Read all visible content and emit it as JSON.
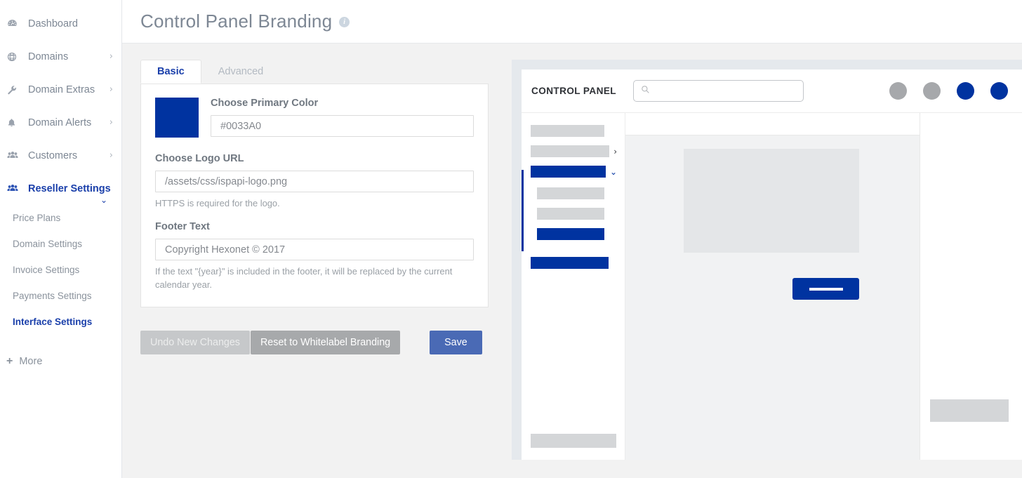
{
  "sidebar": {
    "items": [
      {
        "label": "Dashboard",
        "icon": "dashboard-icon",
        "caret": "",
        "active": false
      },
      {
        "label": "Domains",
        "icon": "globe-icon",
        "caret": "›",
        "active": false
      },
      {
        "label": "Domain Extras",
        "icon": "wrench-icon",
        "caret": "›",
        "active": false
      },
      {
        "label": "Domain Alerts",
        "icon": "bell-icon",
        "caret": "›",
        "active": false
      },
      {
        "label": "Customers",
        "icon": "users-icon",
        "caret": "›",
        "active": false
      },
      {
        "label": "Reseller Settings",
        "icon": "users-icon",
        "caret": "⌄",
        "active": true
      }
    ],
    "subitems": [
      {
        "label": "Price Plans",
        "active": false
      },
      {
        "label": "Domain Settings",
        "active": false
      },
      {
        "label": "Invoice Settings",
        "active": false
      },
      {
        "label": "Payments Settings",
        "active": false
      },
      {
        "label": "Interface Settings",
        "active": true
      }
    ],
    "more": {
      "label": "More",
      "icon": "plus-icon"
    }
  },
  "header": {
    "title": "Control Panel Branding",
    "info_icon": "info-icon",
    "info_glyph": "i"
  },
  "tabs": [
    {
      "label": "Basic",
      "active": true
    },
    {
      "label": "Advanced",
      "active": false
    }
  ],
  "form": {
    "primary_color": {
      "label": "Choose Primary Color",
      "value": "#0033A0",
      "placeholder": "#0033A0",
      "swatch_color": "#0033A0"
    },
    "logo_url": {
      "label": "Choose Logo URL",
      "value": "/assets/css/ispapi-logo.png",
      "placeholder": "/assets/css/ispapi-logo.png",
      "help": "HTTPS is required for the logo."
    },
    "footer_text": {
      "label": "Footer Text",
      "value": "Copyright Hexonet © 2017",
      "placeholder": "Copyright Hexonet © 2017",
      "help": "If the text \"{year}\" is included in the footer, it will be replaced by the current calendar year."
    }
  },
  "buttons": {
    "undo": "Undo New Changes",
    "reset": "Reset to Whitelabel Branding",
    "save": "Save"
  },
  "preview": {
    "logo_text": "CONTROL PANEL",
    "search_placeholder": "",
    "search_icon": "search-icon",
    "circles": [
      "#a6a8ab",
      "#a6a8ab",
      "#0033A0",
      "#0033A0"
    ],
    "nav_rows": [
      {
        "color": "#d4d6d8",
        "chevron": "",
        "width": 122
      },
      {
        "color": "#d4d6d8",
        "chevron": "›",
        "width": 122
      },
      {
        "color": "#0033A0",
        "chevron": "⌄",
        "width": 110
      },
      {
        "color": "#d4d6d8",
        "chevron": "",
        "width": 110
      },
      {
        "color": "#d4d6d8",
        "chevron": "",
        "width": 110
      },
      {
        "color": "#0033A0",
        "chevron": "",
        "width": 110
      }
    ],
    "accent_color": "#0033A0",
    "cta_color": "#0033A0",
    "block_color": "#e4e6e8",
    "cursor_icon": "mouse-cursor-icon"
  },
  "colors": {
    "brand": "#0033A0",
    "nav_active": "#1a3faa",
    "save_button": "#4a6ab5",
    "reset_button": "#a7a9ab",
    "undo_button": "#c6c8ca"
  }
}
